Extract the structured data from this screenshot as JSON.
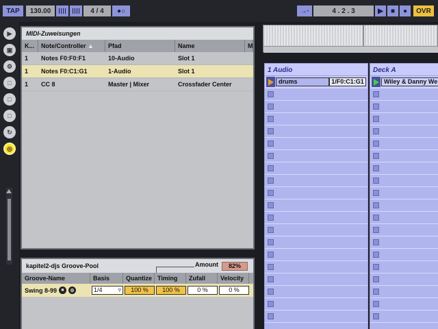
{
  "toolbar": {
    "tap": "TAP",
    "tempo": "130.00",
    "signature": "4 / 4",
    "follow": "→·",
    "position": "4 .  2 .  3",
    "ovr": "OVR"
  },
  "icons": [
    "play-icon",
    "browser-icon",
    "plugin-icon",
    "folder-icon",
    "folder-icon",
    "folder-icon",
    "refresh-icon",
    "target-icon"
  ],
  "midi": {
    "title": "MIDI-Zuweisungen",
    "headers": [
      "K...",
      "Note/Controller",
      "Pfad",
      "Name",
      "M"
    ],
    "rows": [
      [
        "1",
        "Notes F0:F0:F1",
        "10-Audio",
        "Slot 1"
      ],
      [
        "1",
        "Notes F0:C1:G1",
        "1-Audio",
        "Slot 1"
      ],
      [
        "1",
        "CC 8",
        "Master | Mixer",
        "Crossfader Center"
      ]
    ],
    "selected_row": 1
  },
  "groove": {
    "title": "kapitel2-djs Groove-Pool",
    "amount_label": "Amount",
    "amount_value": "82%",
    "headers": [
      "Groove-Name",
      "Basis",
      "Quantize",
      "Timing",
      "Zufall",
      "Velocity"
    ],
    "row": {
      "name": "Swing 8-99",
      "basis": "1/4",
      "quantize": "100 %",
      "timing": "100 %",
      "zufall": "0 %",
      "velocity": "0 %"
    }
  },
  "session": {
    "tracks": [
      {
        "name": "1 Audio",
        "clip": "drums",
        "key": "1/F0:C1:G1"
      },
      {
        "name": "Deck A",
        "clip": "Wiley & Danny We"
      }
    ]
  },
  "colors": {
    "accent_blue": "#8d93d9",
    "track_blue": "#b1b5ee",
    "selection": "#ebe3b2",
    "yellow": "#efc03e"
  }
}
